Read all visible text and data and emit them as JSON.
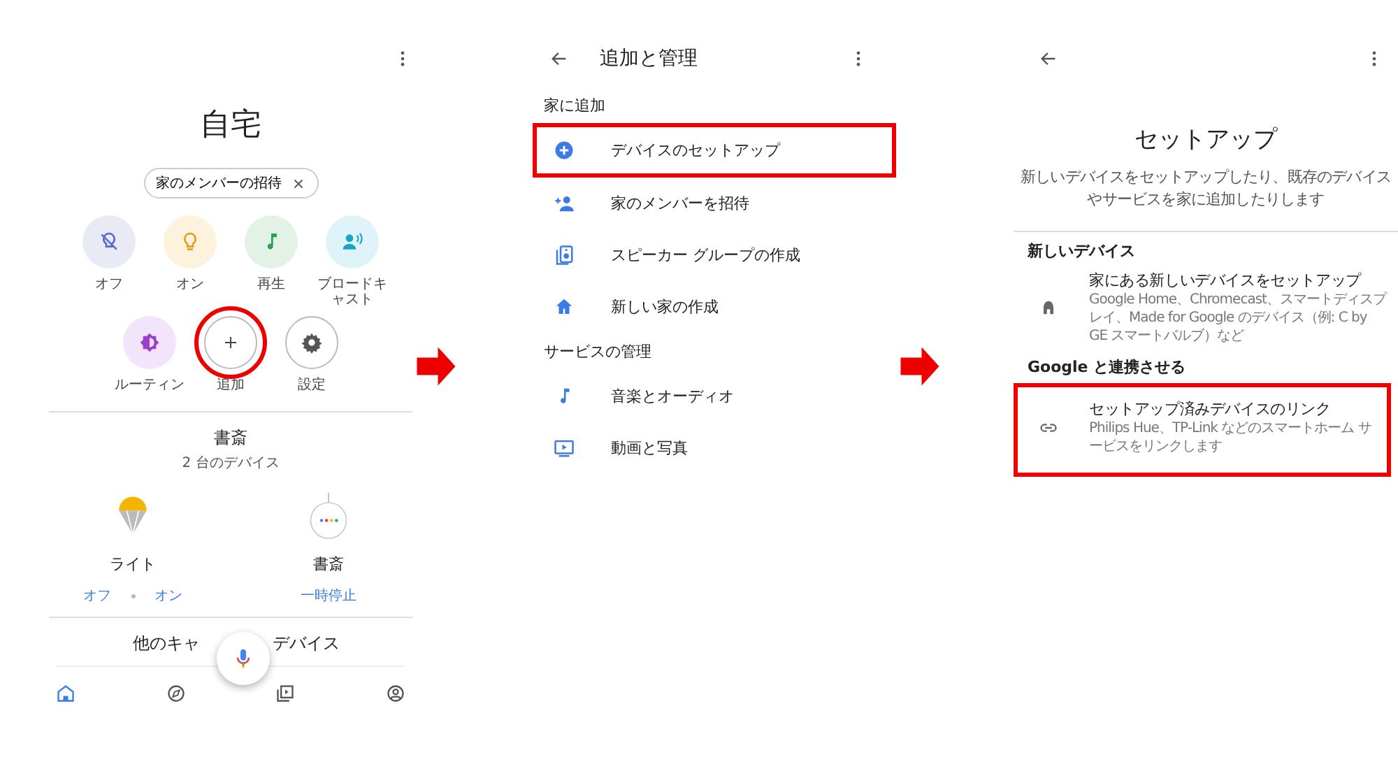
{
  "home_screen": {
    "title": "自宅",
    "chip": {
      "label": "家のメンバーの招待"
    },
    "actions": [
      {
        "label": "オフ",
        "kind": "lights-off",
        "highlighted": false
      },
      {
        "label": "オン",
        "kind": "lights-on",
        "highlighted": false
      },
      {
        "label": "再生",
        "kind": "play",
        "highlighted": false
      },
      {
        "label": "ブロードキャスト",
        "kind": "broadcast",
        "highlighted": false
      },
      {
        "label": "ルーティン",
        "kind": "routine",
        "highlighted": false
      },
      {
        "label": "追加",
        "kind": "add",
        "highlighted": true
      },
      {
        "label": "設定",
        "kind": "settings",
        "highlighted": false
      }
    ],
    "room": {
      "name": "書斎",
      "subtitle": "2 台のデバイス",
      "devices": [
        {
          "name": "ライト",
          "kind": "bulb",
          "controls": [
            "オフ",
            "オン"
          ]
        },
        {
          "name": "書斎",
          "kind": "speaker",
          "controls": [
            "一時停止"
          ]
        }
      ]
    },
    "next_room": {
      "title_parts": [
        "他のキャ",
        "デバイス"
      ]
    },
    "nav": [
      {
        "kind": "home",
        "selected": true
      },
      {
        "kind": "explore",
        "selected": false
      },
      {
        "kind": "media",
        "selected": false
      },
      {
        "kind": "account",
        "selected": false
      }
    ]
  },
  "manage_screen": {
    "title": "追加と管理",
    "sections": [
      {
        "heading": "家に追加",
        "items": [
          {
            "label": "デバイスのセットアップ",
            "kind": "add-circle",
            "highlighted": true
          },
          {
            "label": "家のメンバーを招待",
            "kind": "person-add",
            "highlighted": false
          },
          {
            "label": "スピーカー グループの作成",
            "kind": "speaker-group",
            "highlighted": false
          },
          {
            "label": "新しい家の作成",
            "kind": "home",
            "highlighted": false
          }
        ]
      },
      {
        "heading": "サービスの管理",
        "items": [
          {
            "label": "音楽とオーディオ",
            "kind": "music",
            "highlighted": false
          },
          {
            "label": "動画と写真",
            "kind": "video",
            "highlighted": false
          }
        ]
      }
    ]
  },
  "setup_screen": {
    "title": "セットアップ",
    "description": "新しいデバイスをセットアップしたり、既存のデバイスやサービスを家に追加したりします",
    "sections": [
      {
        "heading": "新しいデバイス",
        "items": [
          {
            "title": "家にある新しいデバイスをセットアップ",
            "description": "Google Home、Chromecast、スマートディスプレイ、Made for Google のデバイス（例: C by GE スマートバルブ）など",
            "kind": "home",
            "highlighted": false
          }
        ]
      },
      {
        "heading": "Google と連携させる",
        "items": [
          {
            "title": "セットアップ済みデバイスのリンク",
            "description": "Philips Hue、TP-Link などのスマートホーム サービスをリンクします",
            "kind": "link",
            "highlighted": true
          }
        ]
      }
    ]
  }
}
